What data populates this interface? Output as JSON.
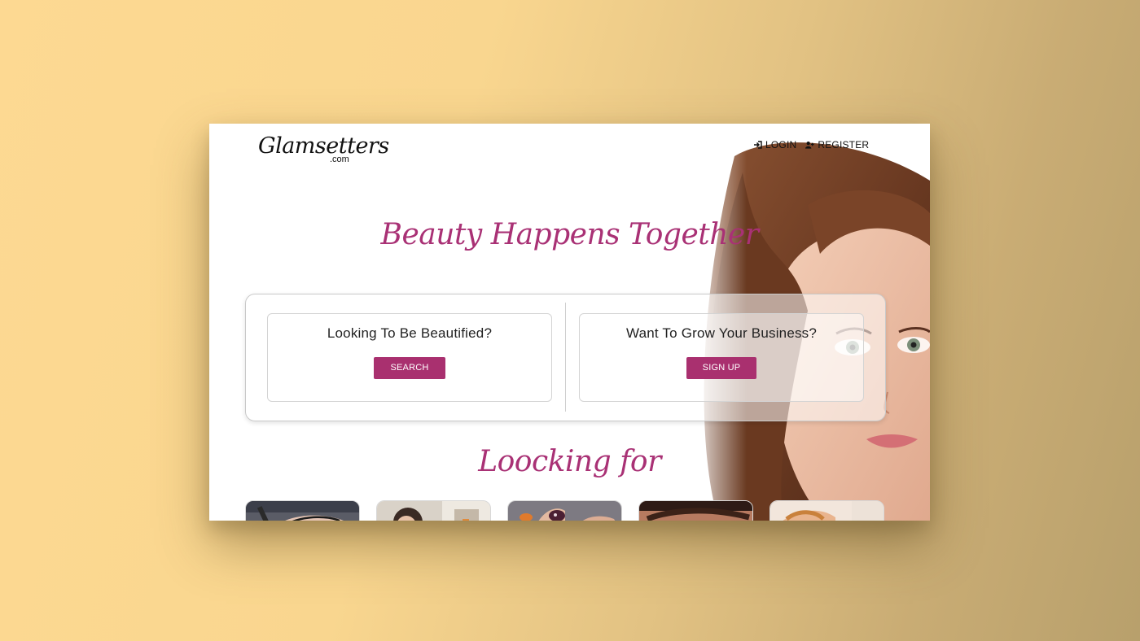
{
  "header": {
    "logo_main": "Glamsetters",
    "logo_sub": ".com",
    "nav": [
      {
        "label": "LOGIN",
        "icon": "sign-in-icon"
      },
      {
        "label": "REGISTER",
        "icon": "user-plus-icon"
      }
    ]
  },
  "hero": {
    "tagline": "Beauty Happens Together"
  },
  "cta": {
    "left": {
      "title": "Looking To Be Beautified?",
      "button": "SEARCH"
    },
    "right": {
      "title": "Want To Grow Your Business?",
      "button": "SIGN UP"
    }
  },
  "services": {
    "heading": "Loocking for",
    "thumbnails": [
      {
        "name": "eye-makeup"
      },
      {
        "name": "hair-styling"
      },
      {
        "name": "nail-art"
      },
      {
        "name": "eyebrows"
      },
      {
        "name": "facial"
      }
    ]
  },
  "colors": {
    "accent": "#a93175",
    "button": "#a9306f",
    "background_gradient_start": "#fdd992",
    "background_gradient_end": "#b8a06c"
  }
}
